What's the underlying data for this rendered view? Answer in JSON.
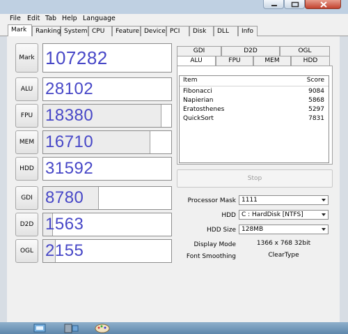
{
  "menu": [
    "File",
    "Edit",
    "Tab",
    "Help",
    "Language"
  ],
  "tabs": [
    "Mark",
    "Ranking",
    "System",
    "CPU",
    "Feature",
    "Device",
    "PCI",
    "Disk",
    "DLL",
    "Info"
  ],
  "rows": [
    {
      "label": "Mark",
      "score": "107282",
      "bar": 0
    },
    {
      "label": "ALU",
      "score": "28102",
      "bar": 0
    },
    {
      "label": "FPU",
      "score": "18380",
      "bar": 0.92
    },
    {
      "label": "MEM",
      "score": "16710",
      "bar": 0.83
    },
    {
      "label": "HDD",
      "score": "31592",
      "bar": 0
    },
    {
      "label": "GDI",
      "score": "8780",
      "bar": 0.43
    },
    {
      "label": "D2D",
      "score": "1563",
      "bar": 0.07
    },
    {
      "label": "OGL",
      "score": "2155",
      "bar": 0.09
    }
  ],
  "right_tabs_top": [
    "GDI",
    "D2D",
    "OGL"
  ],
  "right_tabs_bottom": [
    "ALU",
    "FPU",
    "MEM",
    "HDD"
  ],
  "list": {
    "header_item": "Item",
    "header_score": "Score",
    "rows": [
      {
        "item": "Fibonacci",
        "score": "9084"
      },
      {
        "item": "Napierian",
        "score": "5868"
      },
      {
        "item": "Eratosthenes",
        "score": "5297"
      },
      {
        "item": "QuickSort",
        "score": "7831"
      }
    ]
  },
  "stop_label": "Stop",
  "settings": {
    "processor_mask_label": "Processor Mask",
    "processor_mask_value": "1111",
    "hdd_label": "HDD",
    "hdd_value": "C : HardDisk [NTFS]",
    "hdd_size_label": "HDD Size",
    "hdd_size_value": "128MB",
    "display_mode_label": "Display Mode",
    "display_mode_value": "1366 x 768 32bit",
    "font_smoothing_label": "Font Smoothing",
    "font_smoothing_value": "ClearType"
  },
  "colors": {
    "score_text": "#4747c7",
    "accent": "#5e87ab"
  },
  "icons": {
    "minimize": "minimize-icon",
    "maximize": "maximize-icon",
    "close": "close-icon"
  }
}
